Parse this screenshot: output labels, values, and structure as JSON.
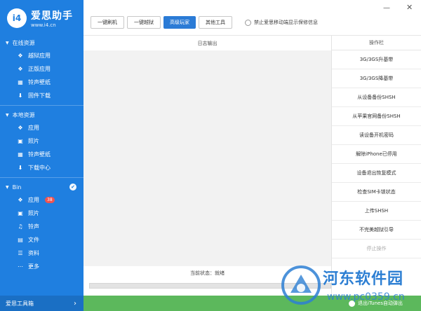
{
  "brand": {
    "badge": "i4",
    "name": "爱思助手",
    "url": "www.i4.cn"
  },
  "sidebar": {
    "sections": [
      {
        "title": "在线资源",
        "items": [
          {
            "label": "越狱应用",
            "icon": "box-icon"
          },
          {
            "label": "正版应用",
            "icon": "box-icon"
          },
          {
            "label": "铃声壁纸",
            "icon": "grid-icon"
          },
          {
            "label": "固件下载",
            "icon": "download-icon"
          }
        ]
      },
      {
        "title": "本地资源",
        "items": [
          {
            "label": "应用",
            "icon": "box-icon"
          },
          {
            "label": "照片",
            "icon": "photo-icon"
          },
          {
            "label": "铃声壁纸",
            "icon": "grid-icon"
          },
          {
            "label": "下载中心",
            "icon": "download-icon"
          }
        ]
      },
      {
        "title": "Bin",
        "items": [
          {
            "label": "应用",
            "icon": "box-icon",
            "badge": "38"
          },
          {
            "label": "照片",
            "icon": "photo-icon"
          },
          {
            "label": "铃声",
            "icon": "bell-icon"
          },
          {
            "label": "文件",
            "icon": "file-icon"
          },
          {
            "label": "资料",
            "icon": "contact-icon"
          },
          {
            "label": "更多",
            "icon": "more-icon"
          }
        ]
      }
    ],
    "check_mark": "✔",
    "toolbox_label": "爱思工具箱",
    "toolbox_arrow": "›"
  },
  "toolbar": {
    "tabs": [
      "一键刷机",
      "一键越狱",
      "高级玩家",
      "其他工具"
    ],
    "active_tab": 2,
    "checkbox_label": "禁止爱思移动端显示保修信息",
    "minimize": "—",
    "close": "✕"
  },
  "log": {
    "header": "日志输出",
    "status": "当前状态：就绪"
  },
  "ops": {
    "header": "操作栏",
    "buttons": [
      {
        "label": "3G/3GS升基带",
        "enabled": true
      },
      {
        "label": "3G/3GS降基带",
        "enabled": true
      },
      {
        "label": "从设备备份SHSH",
        "enabled": true
      },
      {
        "label": "从苹果官网备份SHSH",
        "enabled": true
      },
      {
        "label": "读设备开机密码",
        "enabled": true
      },
      {
        "label": "解除iPhone已停用",
        "enabled": true
      },
      {
        "label": "设备退出恢复模式",
        "enabled": true
      },
      {
        "label": "检查SIM卡锁状态",
        "enabled": true
      },
      {
        "label": "上传SHSH",
        "enabled": true
      },
      {
        "label": "不完美越狱引导",
        "enabled": true
      },
      {
        "label": "停止操作",
        "enabled": false
      }
    ],
    "itunes_label": "退出iTunes自动弹出"
  },
  "watermark": {
    "title": "河东软件园",
    "url": "www.pc0359.cn"
  },
  "colors": {
    "sidebar": "#1f7fe0",
    "accent": "#2b7bd6",
    "bottom_bar": "#5cb85c",
    "badge": "#ef5350"
  }
}
